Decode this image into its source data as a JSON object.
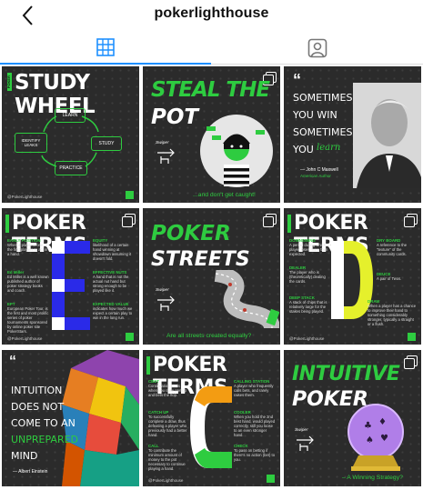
{
  "header": {
    "username": "pokerlighthouse"
  },
  "handle": "@PokerLighthouse",
  "posts": [
    {
      "title_prefix": "POKER",
      "title": "STUDY WHEEL",
      "nodes": [
        "LEARN",
        "STUDY",
        "PRACTICE",
        "IDENTIFY LEAKS"
      ]
    },
    {
      "title_line1": "STEAL THE",
      "title_line2": "POT",
      "swipe": "Swipe!",
      "caption": "...and don't get caught!"
    },
    {
      "quote_line1": "SOMETIMES",
      "quote_line2": "YOU WIN",
      "quote_line3": "SOMETIMES",
      "quote_line4": "YOU",
      "quote_word": "learn",
      "author": "— John C Maxwell",
      "author_role": "American Author"
    },
    {
      "title": "POKER TERMS",
      "letter": "E",
      "terms": [
        {
          "name": "EARLY POSITION",
          "text": "When a player is one of the first players to act in a hand."
        },
        {
          "name": "EQUITY",
          "text": "likelihood of a certain hand winning at showdown assuming it doesn't fold."
        },
        {
          "name": "Ed Miller",
          "text": "Ed Miller is a well known published author of poker strategy books and coach."
        },
        {
          "name": "EFFECTIVE NUTS",
          "text": "A hand that is not the actual nut hand but strong enough to be played like it."
        },
        {
          "name": "EPT",
          "text": "European Poker Tour, is the first and most prolific series of poker tournaments sponsored by online poker site PokerStars."
        },
        {
          "name": "EXPECTED VALUE",
          "text": "indicates how much we expect a certain play to win in the long run."
        }
      ]
    },
    {
      "title_line1": "POKER",
      "title_line2": "STREETS",
      "swipe": "Swipe!",
      "caption": "Are all streets created equally?"
    },
    {
      "title": "POKER TERMS",
      "letter": "D",
      "terms": [
        {
          "name": "DOWNSWING",
          "text": "A period during which a player loses more than expected."
        },
        {
          "name": "DRY BOARD",
          "text": "A reference to the \"texture\" of the community cards."
        },
        {
          "name": "DEALER",
          "text": "The player who is (theoretically) dealing the cards."
        },
        {
          "name": "DEUCE",
          "text": "A pair of Twos."
        },
        {
          "name": "DEEP STACK",
          "text": "A stack of chips that is relatively large for the stakes being played."
        },
        {
          "name": "DRAW",
          "text": "When a player has a chance to improve their hand to something considerably stronger, typically a straight or a flush."
        }
      ]
    },
    {
      "quote_line1": "INTUITION",
      "quote_line2": "DOES NOT",
      "quote_line3": "COME TO AN",
      "quote_line4": "UNPREPARED",
      "quote_line5": "MIND",
      "author": "— Albert Einstein"
    },
    {
      "title": "POKER TERMS",
      "letter": "C",
      "terms": [
        {
          "name": "CBET",
          "text": "Continuation Bet is when you raise preflop and bets the flop."
        },
        {
          "name": "CALLING STATION",
          "text": "A player who frequently calls bets, and rarely raises them."
        },
        {
          "name": "CATCH UP",
          "text": "To successfully complete a draw, thus defeating a player who previously had a better hand."
        },
        {
          "name": "COOLER",
          "text": "When you hold the 2nd best hand, would played correctly, still you loose to an even stronger hand."
        },
        {
          "name": "CALL",
          "text": "To contribute the minimum amount of money to the pot necessary to continue playing a hand."
        },
        {
          "name": "CHECK",
          "text": "To pass on betting if there's no action (bet) to you."
        }
      ]
    },
    {
      "title_line1": "INTUITIVE",
      "title_line2": "POKER",
      "swipe": "Swipe!",
      "caption": "– A Winning Strategy?"
    }
  ]
}
